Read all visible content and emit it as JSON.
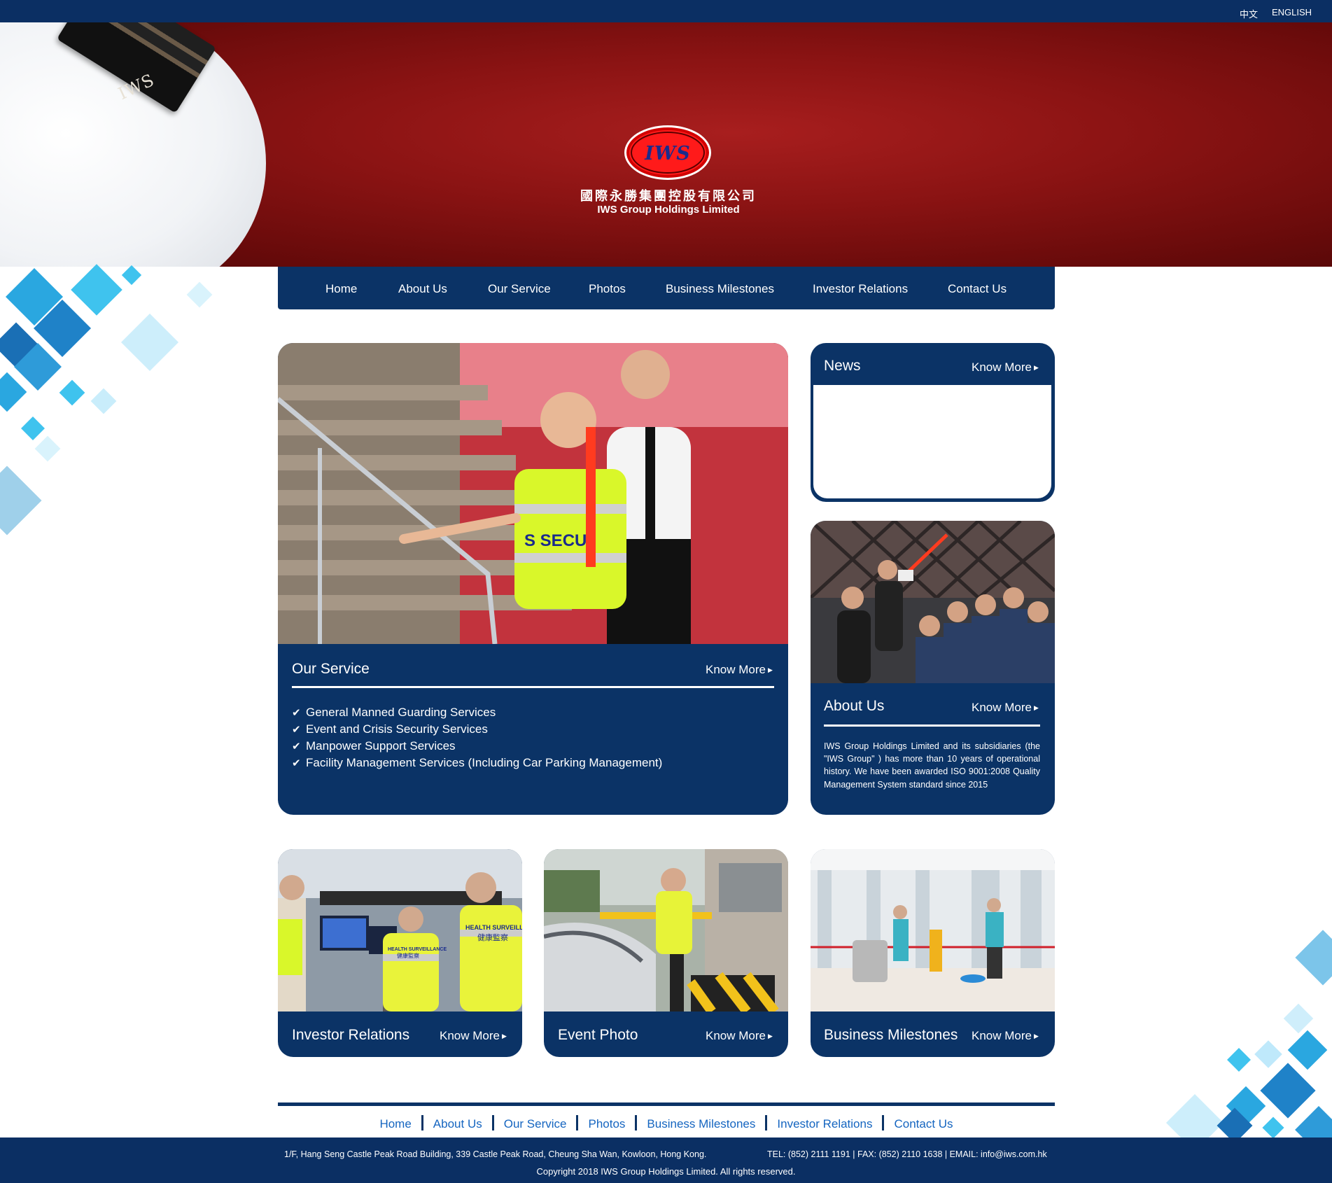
{
  "header": {
    "lang_zh": "中文",
    "lang_en": "ENGLISH",
    "logo_mark": "IWS",
    "company_cn": "國際永勝集團控股有限公司",
    "company_en": "IWS Group Holdings Limited",
    "epaulette_text": "IWS"
  },
  "nav": {
    "items": [
      "Home",
      "About Us",
      "Our Service",
      "Photos",
      "Business Milestones",
      "Investor Relations",
      "Contact Us"
    ]
  },
  "service_card": {
    "title": "Our Service",
    "know_more": "Know More",
    "photo_badge": "S SECU",
    "items": [
      "General Manned Guarding Services",
      "Event and Crisis Security Services",
      "Manpower Support Services",
      "Facility Management Services (Including Car Parking Management)"
    ]
  },
  "news_card": {
    "title": "News",
    "know_more": "Know More"
  },
  "about_card": {
    "title": "About Us",
    "know_more": "Know More",
    "text": "IWS Group Holdings Limited and its subsidiaries (the \"IWS Group\" ) has more than 10 years of operational history. We have been awarded ISO 9001:2008 Quality Management System standard since 2015"
  },
  "investor_card": {
    "title": "Investor Relations",
    "know_more": "Know More",
    "vest_text_en": "HEALTH SURVEILLANCE",
    "vest_text_cn": "健康監察"
  },
  "event_card": {
    "title": "Event Photo",
    "know_more": "Know More"
  },
  "milestones_card": {
    "title": "Business Milestones",
    "know_more": "Know More"
  },
  "footer": {
    "links": [
      "Home",
      "About Us",
      "Our Service",
      "Photos",
      "Business Milestones",
      "Investor Relations",
      "Contact Us"
    ],
    "address": "1/F, Hang Seng Castle Peak Road Building, 339 Castle Peak Road, Cheung Sha Wan, Kowloon, Hong Kong.",
    "contact": "TEL: (852) 2111 1191 | FAX: (852) 2110 1638 | EMAIL: info@iws.com.hk",
    "copyright": "Copyright 2018 IWS Group Holdings Limited. All rights reserved."
  },
  "colors": {
    "brand_navy": "#0b3366",
    "topbar_navy": "#0b2f63",
    "hero_red": "#8a1313",
    "logo_red": "#ff1a1a",
    "link_blue": "#1565c0",
    "diamond_blue": "#2aa7e0"
  },
  "icons": [
    "check-icon",
    "arrow-right-icon",
    "diamond-pattern"
  ]
}
